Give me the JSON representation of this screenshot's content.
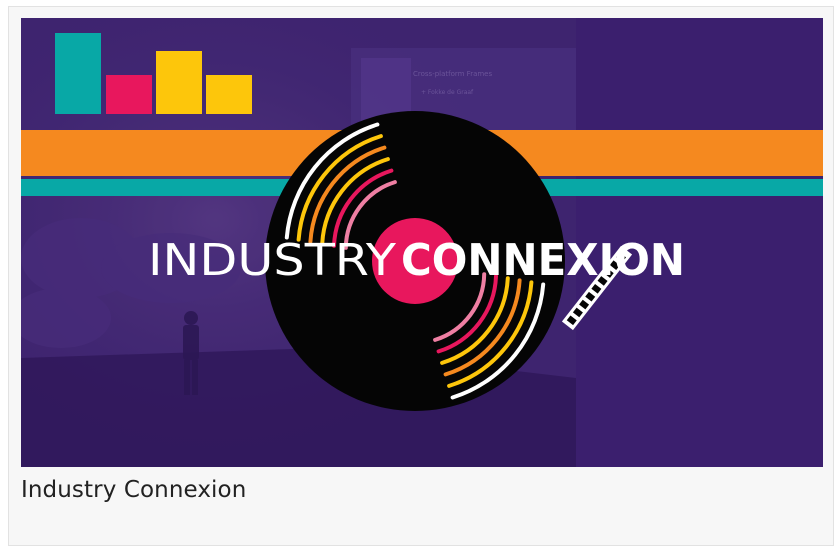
{
  "card": {
    "title": "Industry Connexion"
  },
  "banner": {
    "title_part1": "INDUSTRY",
    "title_part2": "CONNEXION",
    "background_text_line1": "Cross-platform Frames",
    "background_text_line2": "+ Fokke de Graaf"
  },
  "colors": {
    "purple": "#3b1f6e",
    "orange": "#f5891f",
    "teal": "#08a8a6",
    "pink": "#e8175d",
    "yellow": "#fdc60b",
    "vinyl": "#050505"
  },
  "icons": {
    "logo": "bar-chart-logo-icon",
    "record": "vinyl-record-icon",
    "film": "film-strip-icon"
  }
}
